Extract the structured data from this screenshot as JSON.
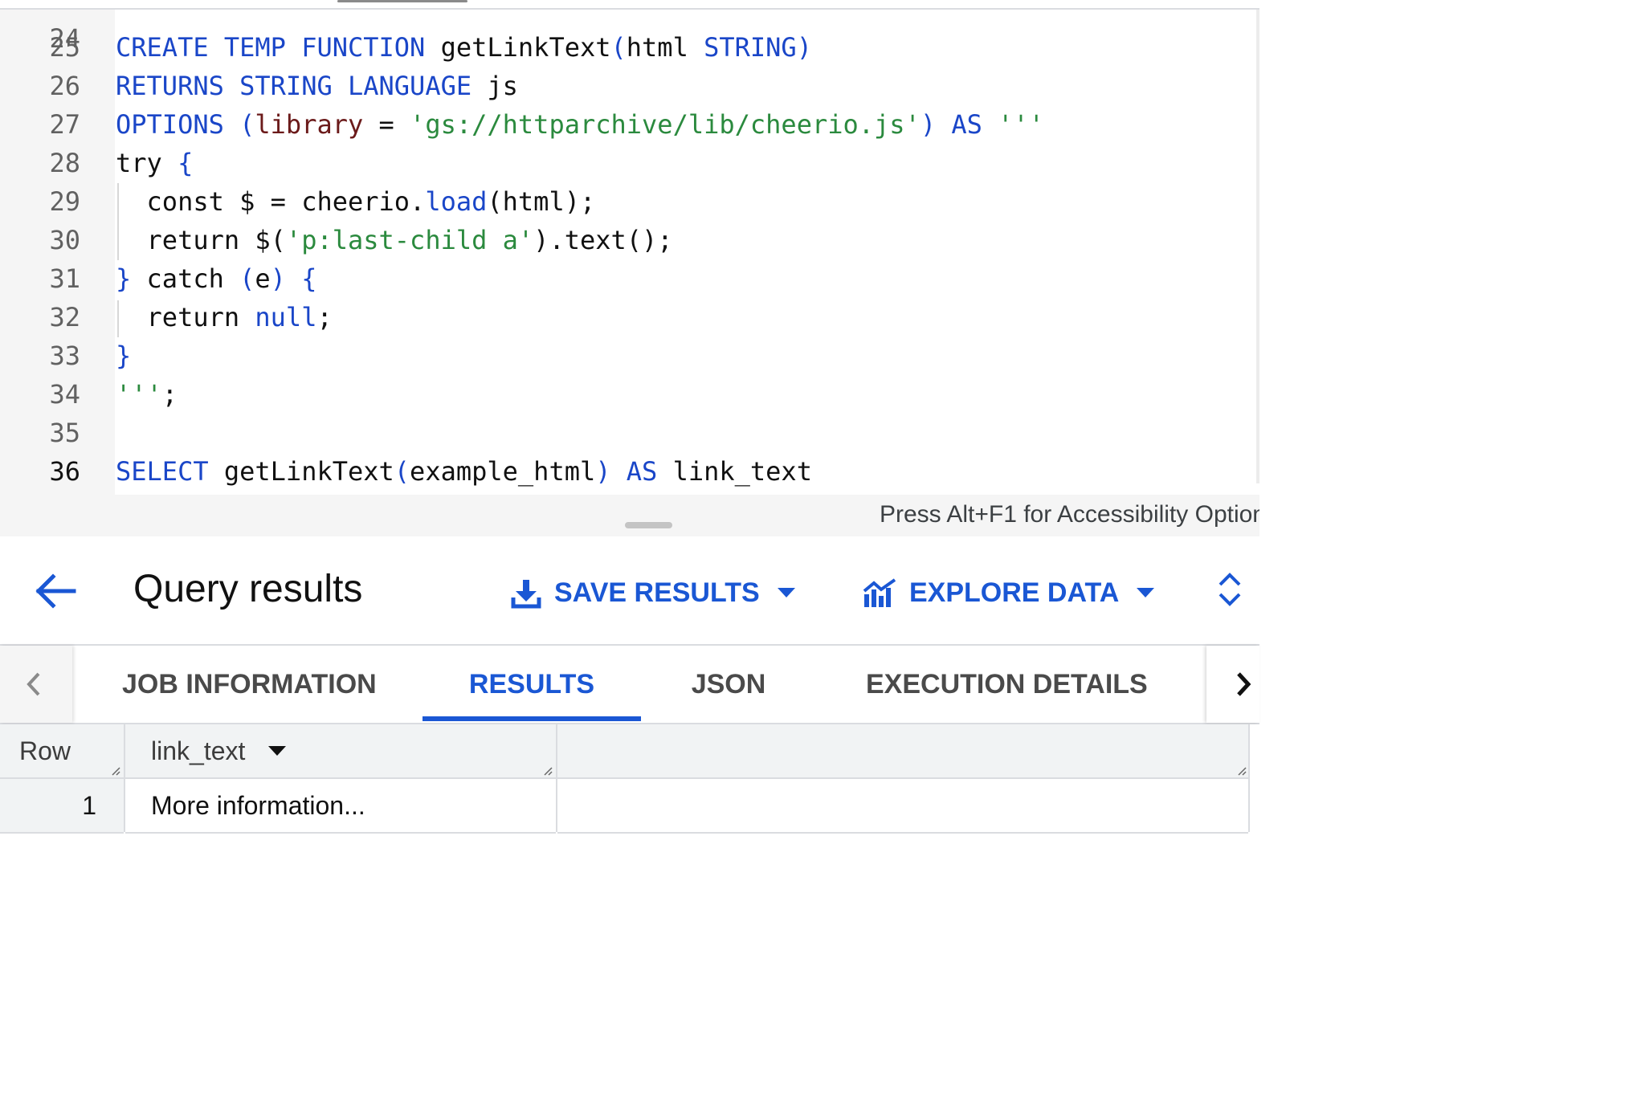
{
  "editor": {
    "partial_top_line_number": "24",
    "lines": [
      {
        "n": "25",
        "tokens": [
          [
            "kw",
            "CREATE TEMP FUNCTION "
          ],
          [
            "pl",
            "getLinkText"
          ],
          [
            "kw",
            "("
          ],
          [
            "pl",
            "html "
          ],
          [
            "kw",
            "STRING)"
          ]
        ]
      },
      {
        "n": "26",
        "tokens": [
          [
            "kw",
            "RETURNS STRING LANGUAGE "
          ],
          [
            "pl",
            "js"
          ]
        ]
      },
      {
        "n": "27",
        "tokens": [
          [
            "kw",
            "OPTIONS ("
          ],
          [
            "pa",
            "library"
          ],
          [
            "pl",
            " = "
          ],
          [
            "st",
            "'gs://httparchive/lib/cheerio.js'"
          ],
          [
            "kw",
            ") AS "
          ],
          [
            "st",
            "'''"
          ]
        ]
      },
      {
        "n": "28",
        "tokens": [
          [
            "pl",
            "try "
          ],
          [
            "kw",
            "{"
          ]
        ]
      },
      {
        "n": "29",
        "tokens": [
          [
            "pl",
            "  const $ = cheerio."
          ],
          [
            "kw",
            "load"
          ],
          [
            "pl",
            "(html);"
          ]
        ]
      },
      {
        "n": "30",
        "tokens": [
          [
            "pl",
            "  return $("
          ],
          [
            "st",
            "'p:last-child a'"
          ],
          [
            "pl",
            ").text();"
          ]
        ]
      },
      {
        "n": "31",
        "tokens": [
          [
            "kw",
            "} "
          ],
          [
            "pl",
            "catch "
          ],
          [
            "kw",
            "("
          ],
          [
            "pl",
            "e"
          ],
          [
            "kw",
            ") {"
          ]
        ]
      },
      {
        "n": "32",
        "tokens": [
          [
            "pl",
            "  return "
          ],
          [
            "kw",
            "null"
          ],
          [
            "pl",
            ";"
          ]
        ]
      },
      {
        "n": "33",
        "tokens": [
          [
            "kw",
            "}"
          ]
        ]
      },
      {
        "n": "34",
        "tokens": [
          [
            "st",
            "'''"
          ],
          [
            "pl",
            ";"
          ]
        ]
      },
      {
        "n": "35",
        "tokens": []
      },
      {
        "n": "36",
        "tokens": [
          [
            "kw",
            "SELECT "
          ],
          [
            "pl",
            "getLinkText"
          ],
          [
            "kw",
            "("
          ],
          [
            "pl",
            "example_html"
          ],
          [
            "kw",
            ") AS "
          ],
          [
            "pl",
            "link_text"
          ]
        ]
      }
    ],
    "accessibility_hint": "Press Alt+F1 for Accessibility Option"
  },
  "results_header": {
    "title": "Query results",
    "save_label": "SAVE RESULTS",
    "explore_label": "EXPLORE DATA"
  },
  "tabs": {
    "job_information": "JOB INFORMATION",
    "results": "RESULTS",
    "json": "JSON",
    "execution_details": "EXECUTION DETAILS",
    "active": "RESULTS"
  },
  "table": {
    "columns": {
      "row": "Row",
      "link_text": "link_text"
    },
    "rows": [
      {
        "row": "1",
        "link_text": "More information..."
      }
    ]
  },
  "colors": {
    "accent": "#1a57d4",
    "keyword": "#1a46c8",
    "string": "#2b8a3e",
    "param": "#6b1a1a"
  }
}
